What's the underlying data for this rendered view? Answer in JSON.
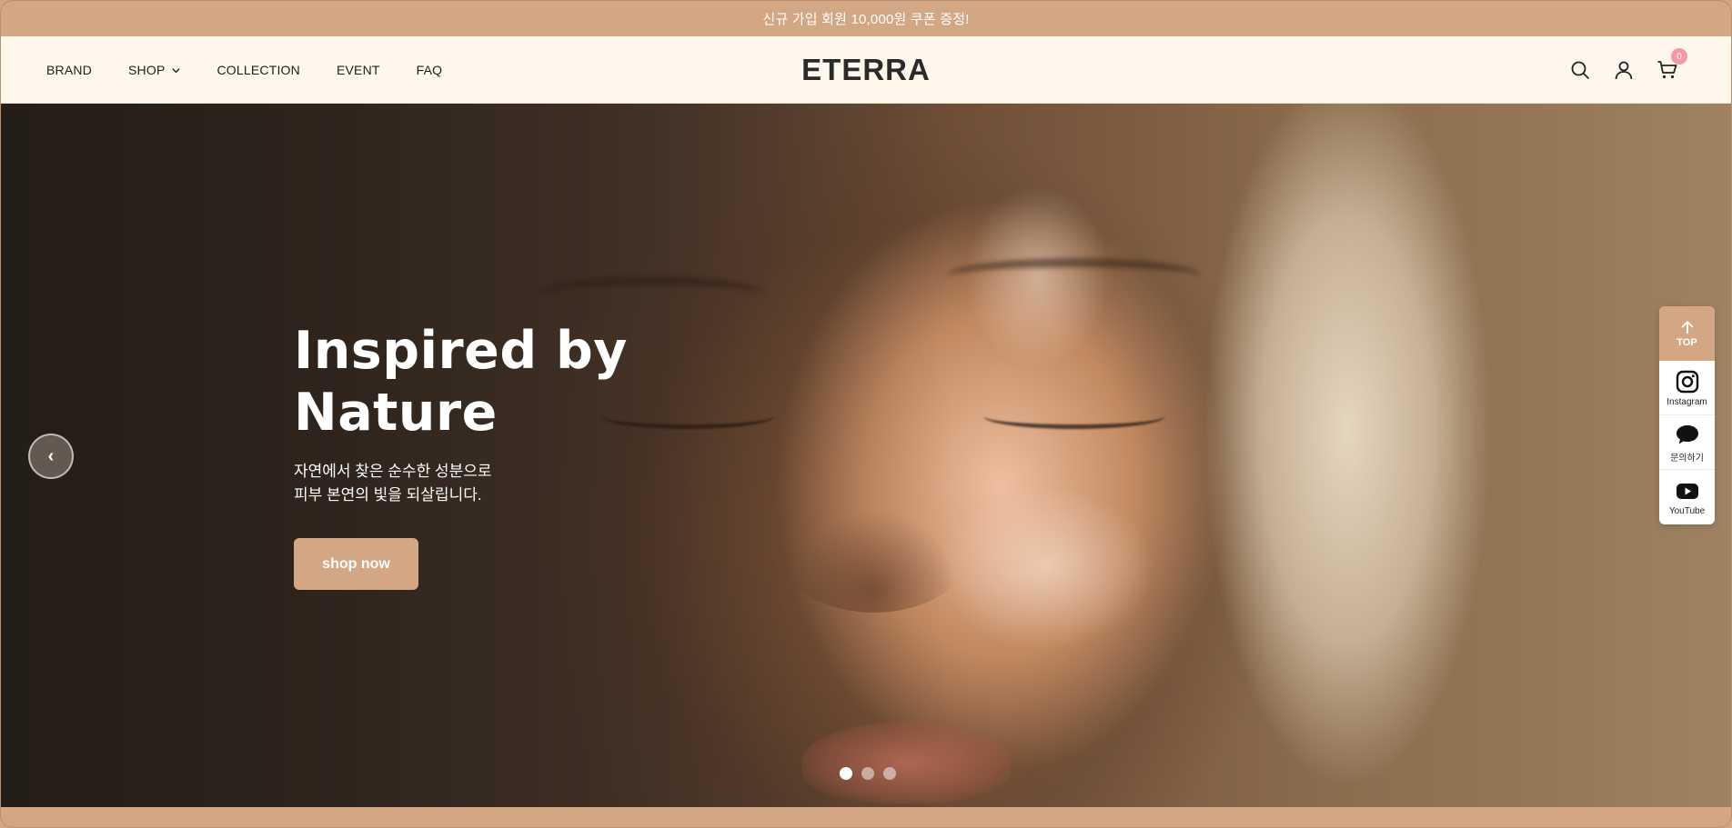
{
  "announcement": "신규 가입 회원 10,000원 쿠폰 증정!",
  "nav": {
    "items": [
      {
        "label": "BRAND"
      },
      {
        "label": "SHOP"
      },
      {
        "label": "COLLECTION"
      },
      {
        "label": "EVENT"
      },
      {
        "label": "FAQ"
      }
    ]
  },
  "logo": "ETERRA",
  "header_icons": {
    "search": "search-icon",
    "account": "user-icon",
    "cart": "cart-icon",
    "cart_count": "0"
  },
  "hero": {
    "title_line1": "Inspired by",
    "title_line2": "Nature",
    "sub_line1": "자연에서 찾은 순수한 성분으로",
    "sub_line2": "피부 본연의 빛을 되살립니다.",
    "button": "shop now",
    "prev_arrow": "‹",
    "slides": 3,
    "active_slide": 1
  },
  "quick_menu": {
    "top": "TOP",
    "items": [
      {
        "label": "Instagram",
        "icon": "instagram-icon"
      },
      {
        "label": "문의하기",
        "icon": "chat-icon"
      },
      {
        "label": "YouTube",
        "icon": "youtube-icon"
      }
    ]
  },
  "colors": {
    "accent": "#d3a684",
    "header_bg": "#fff7ec",
    "badge": "#f49aa6"
  }
}
